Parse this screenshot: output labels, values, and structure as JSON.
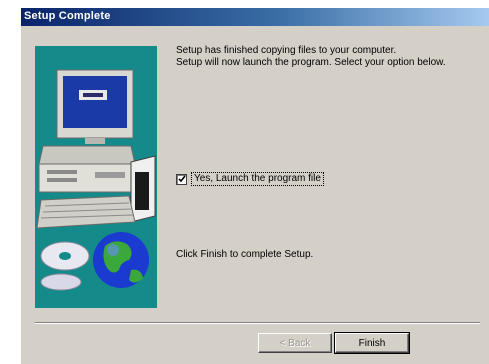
{
  "window": {
    "title": "Setup Complete"
  },
  "message": {
    "line1": "Setup has finished copying files to your computer.",
    "line2": "Setup will now launch the program. Select your option below."
  },
  "launch_option": {
    "label": "Yes, Launch the program file",
    "checked": true
  },
  "footer_message": "Click Finish to complete Setup.",
  "buttons": {
    "back": "< Back",
    "finish": "Finish"
  },
  "colors": {
    "titlebar": "#0a246a",
    "dialog_bg": "#d4d0c8",
    "art_bg": "#158a8a"
  },
  "icons": [
    "computer-icon",
    "cd-disc-icon",
    "globe-icon",
    "checkmark-icon"
  ]
}
